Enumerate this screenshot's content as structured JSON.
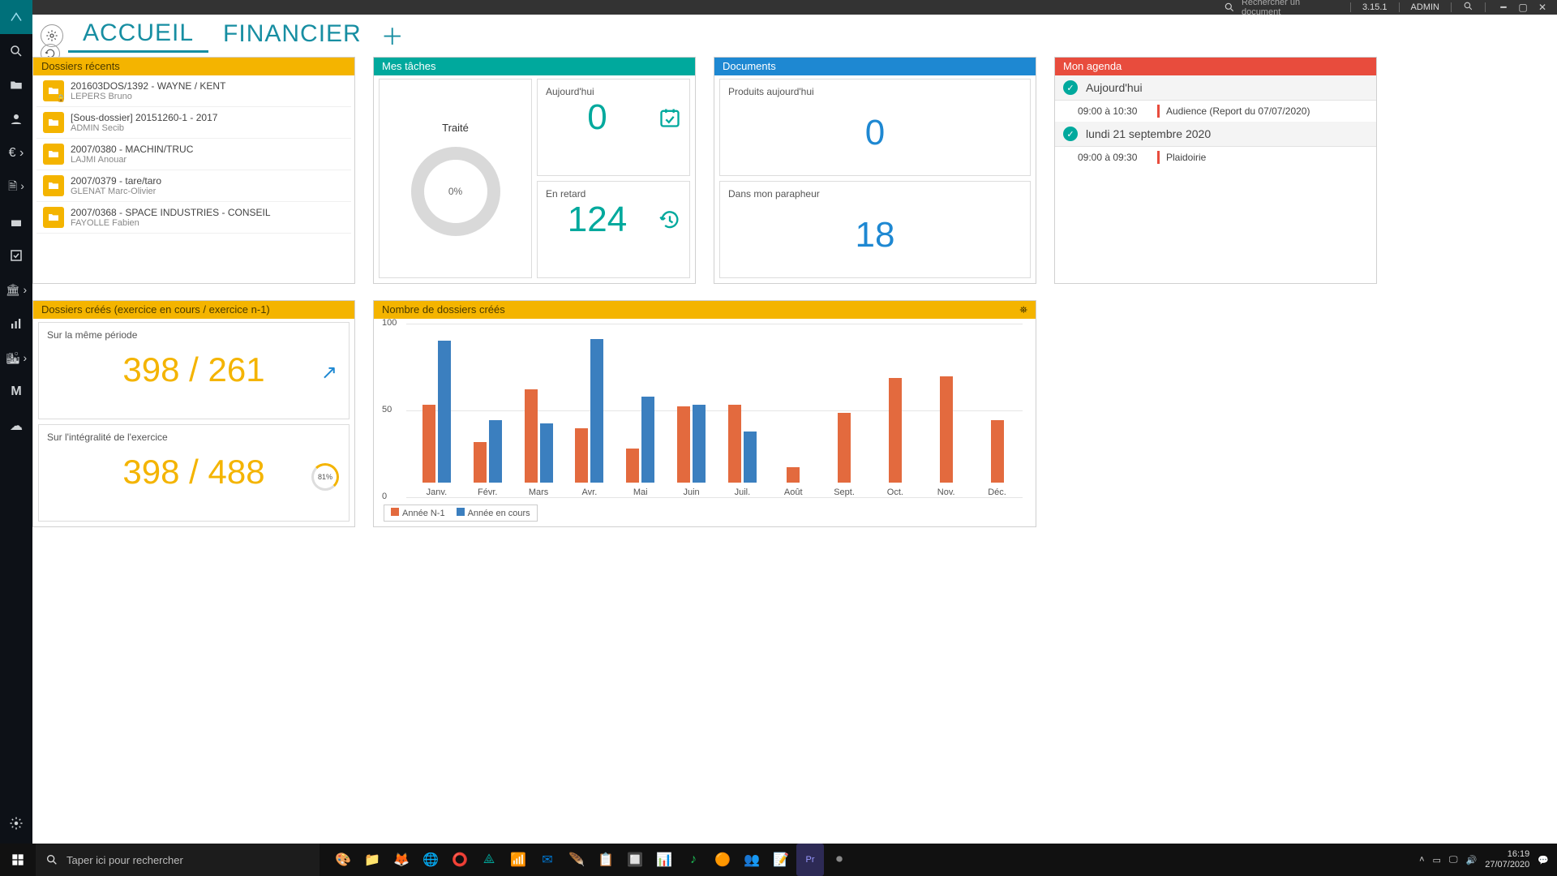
{
  "topbar": {
    "search_placeholder": "Rechercher un document",
    "version": "3.15.1",
    "user": "ADMIN"
  },
  "tabs": {
    "accueil": "ACCUEIL",
    "financier": "FINANCIER"
  },
  "recent": {
    "title": "Dossiers récents",
    "items": [
      {
        "title": "201603DOS/1392 - WAYNE / KENT",
        "sub": "LEPERS Bruno",
        "locked": true
      },
      {
        "title": "[Sous-dossier]  20151260-1 - 2017",
        "sub": "ADMIN Secib",
        "locked": false
      },
      {
        "title": "2007/0380 - MACHIN/TRUC",
        "sub": "LAJMI Anouar",
        "locked": false
      },
      {
        "title": "2007/0379 - tare/taro",
        "sub": "GLENAT Marc-Olivier",
        "locked": false
      },
      {
        "title": "2007/0368 - SPACE INDUSTRIES - CONSEIL",
        "sub": "FAYOLLE Fabien",
        "locked": false
      }
    ]
  },
  "tasks": {
    "title": "Mes tâches",
    "today_label": "Aujourd'hui",
    "today_value": "0",
    "late_label": "En retard",
    "late_value": "124",
    "processed_label": "Traité",
    "processed_pct": "0%"
  },
  "docs": {
    "title": "Documents",
    "today_label": "Produits aujourd'hui",
    "today_value": "0",
    "para_label": "Dans mon parapheur",
    "para_value": "18"
  },
  "agenda": {
    "title": "Mon agenda",
    "days": [
      {
        "label": "Aujourd'hui",
        "events": [
          {
            "time": "09:00 à 10:30",
            "title": "Audience (Report du 07/07/2020)"
          }
        ]
      },
      {
        "label": "lundi 21 septembre 2020",
        "events": [
          {
            "time": "09:00 à 09:30",
            "title": "Plaidoirie"
          }
        ]
      }
    ]
  },
  "counts": {
    "title": "Dossiers créés (exercice en cours / exercice n-1)",
    "period_label": "Sur la même période",
    "period_value": "398 / 261",
    "full_label": "Sur l'intégralité de l'exercice",
    "full_value": "398 / 488",
    "pct": "81%"
  },
  "chart_title": "Nombre de dossiers créés",
  "chart_data": {
    "type": "bar",
    "categories": [
      "Janv.",
      "Févr.",
      "Mars",
      "Avr.",
      "Mai",
      "Juin",
      "Juil.",
      "Août",
      "Sept.",
      "Oct.",
      "Nov.",
      "Déc."
    ],
    "series": [
      {
        "name": "Année N-1",
        "color": "#e36a3e",
        "values": [
          50,
          26,
          60,
          35,
          22,
          49,
          50,
          10,
          45,
          67,
          68,
          40
        ]
      },
      {
        "name": "Année en cours",
        "color": "#3b7fbf",
        "values": [
          91,
          40,
          38,
          92,
          55,
          50,
          33,
          0,
          0,
          0,
          0,
          0
        ]
      }
    ],
    "ylim": [
      0,
      100
    ],
    "yticks": [
      0,
      50,
      100
    ],
    "title": "Nombre de dossiers créés",
    "xlabel": "",
    "ylabel": ""
  },
  "taskbar": {
    "search_placeholder": "Taper ici pour rechercher",
    "time": "16:19",
    "date": "27/07/2020"
  }
}
